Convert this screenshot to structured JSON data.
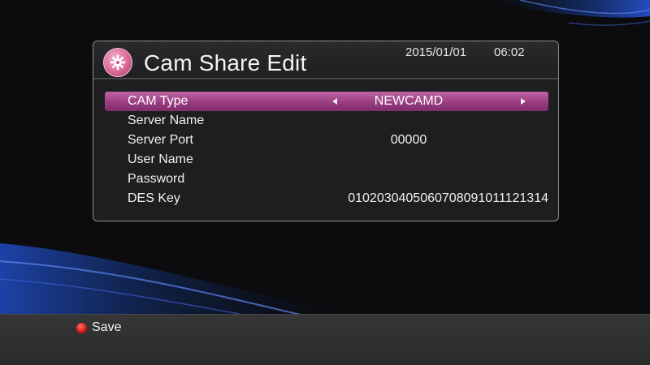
{
  "header": {
    "title": "Cam Share Edit",
    "date": "2015/01/01",
    "time": "06:02",
    "icon": "gear-icon"
  },
  "fields": [
    {
      "label": "CAM Type",
      "value": "NEWCAMD",
      "selected": true,
      "has_arrows": true
    },
    {
      "label": "Server Name",
      "value": ""
    },
    {
      "label": "Server Port",
      "value": "00000"
    },
    {
      "label": "User Name",
      "value": ""
    },
    {
      "label": "Password",
      "value": ""
    },
    {
      "label": "DES Key",
      "value": "0102030405060708091011121314"
    }
  ],
  "footer": {
    "save_label": "Save",
    "save_key_color": "#d81616"
  },
  "colors": {
    "selection": "#9a3d82",
    "panel_bg": "#1e1e20",
    "accent_blue": "#1b3a9a"
  }
}
